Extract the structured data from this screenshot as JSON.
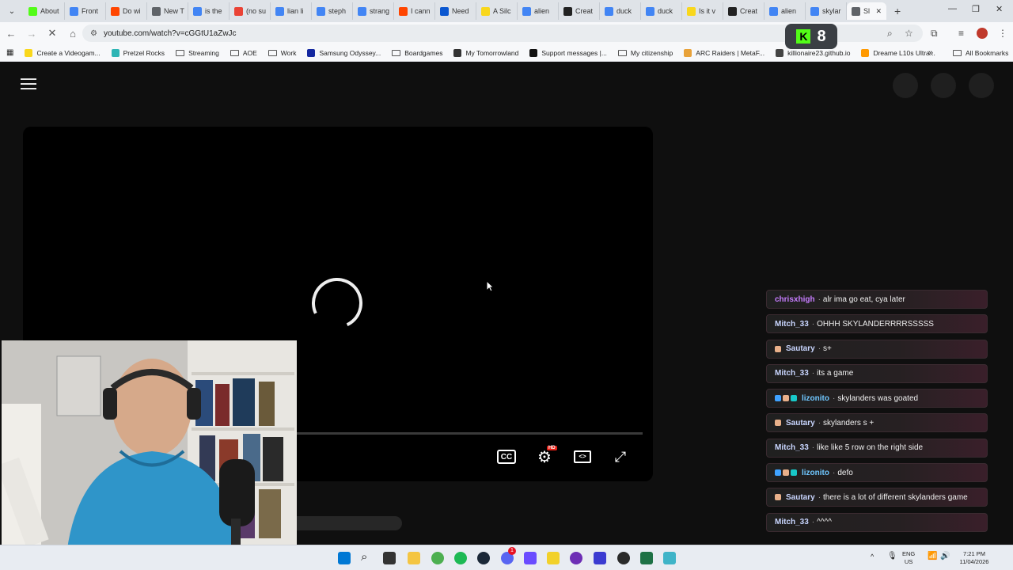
{
  "browser": {
    "tabs": [
      {
        "label": "About",
        "color": "#53fc18"
      },
      {
        "label": "Front",
        "color": "#4285f4"
      },
      {
        "label": "Do wi",
        "color": "#ff4500"
      },
      {
        "label": "New T",
        "color": "#5f6368"
      },
      {
        "label": "is the",
        "color": "#4285f4"
      },
      {
        "label": "(no su",
        "color": "#ea4335"
      },
      {
        "label": "lian li",
        "color": "#4285f4"
      },
      {
        "label": "steph",
        "color": "#4285f4"
      },
      {
        "label": "strang",
        "color": "#4285f4"
      },
      {
        "label": "I cann",
        "color": "#ff4500"
      },
      {
        "label": "Need",
        "color": "#0b57d0"
      },
      {
        "label": "A Silc",
        "color": "#f9d71c"
      },
      {
        "label": "alien",
        "color": "#4285f4"
      },
      {
        "label": "Creat",
        "color": "#222222"
      },
      {
        "label": "duck",
        "color": "#4285f4"
      },
      {
        "label": "duck",
        "color": "#4285f4"
      },
      {
        "label": "Is it v",
        "color": "#f9d71c"
      },
      {
        "label": "Creat",
        "color": "#222222"
      },
      {
        "label": "alien",
        "color": "#4285f4"
      },
      {
        "label": "skylar",
        "color": "#4285f4"
      },
      {
        "label": "Sl",
        "color": "#5f6368",
        "active": true
      }
    ],
    "new_tab": "+",
    "url": "youtube.com/watch?v=cGGtU1aZwJc",
    "kick_badge": "8",
    "bookmarks": [
      {
        "label": "Create a Videogam...",
        "type": "icon",
        "color": "#f9d71c"
      },
      {
        "label": "Pretzel Rocks",
        "type": "icon",
        "color": "#2eb5b5"
      },
      {
        "label": "Streaming",
        "type": "folder"
      },
      {
        "label": "AOE",
        "type": "folder"
      },
      {
        "label": "Work",
        "type": "folder"
      },
      {
        "label": "Samsung Odyssey...",
        "type": "icon",
        "color": "#1428a0"
      },
      {
        "label": "Boardgames",
        "type": "folder"
      },
      {
        "label": "My Tomorrowland",
        "type": "icon",
        "color": "#333333"
      },
      {
        "label": "Support messages |...",
        "type": "icon",
        "color": "#111111"
      },
      {
        "label": "My citizenship",
        "type": "folder"
      },
      {
        "label": "ARC Raiders | MetaF...",
        "type": "icon",
        "color": "#e8a23a"
      },
      {
        "label": "killionaire23.github.io",
        "type": "icon",
        "color": "#444444"
      },
      {
        "label": "Dreame L10s Ultra...",
        "type": "icon",
        "color": "#ff9900"
      }
    ],
    "all_bookmarks": "All Bookmarks",
    "bookmarks_more": "»"
  },
  "player": {
    "cc_label": "CC",
    "hd_badge": "HD"
  },
  "chat": [
    {
      "user": "chrisxhigh",
      "color": "#c77dff",
      "text": "alr ima go eat, cya later",
      "badges": []
    },
    {
      "user": "Mitch_33",
      "color": "#c9d6ff",
      "text": "OHHH SKYLANDERRRRSSSSS",
      "badges": []
    },
    {
      "user": "Sautary",
      "color": "#c9d6ff",
      "text": "s+",
      "badges": [
        "#e8b08a"
      ]
    },
    {
      "user": "Mitch_33",
      "color": "#c9d6ff",
      "text": "its a game",
      "badges": []
    },
    {
      "user": "lizonito",
      "color": "#6fc7ff",
      "text": "skylanders was goated",
      "badges": [
        "#3fa2ff",
        "#e8b08a",
        "#18c8c8"
      ]
    },
    {
      "user": "Sautary",
      "color": "#c9d6ff",
      "text": "skylanders s +",
      "badges": [
        "#e8b08a"
      ]
    },
    {
      "user": "Mitch_33",
      "color": "#c9d6ff",
      "text": "like like 5 row on the right side",
      "badges": []
    },
    {
      "user": "lizonito",
      "color": "#6fc7ff",
      "text": "defo",
      "badges": [
        "#3fa2ff",
        "#e8b08a",
        "#18c8c8"
      ]
    },
    {
      "user": "Sautary",
      "color": "#c9d6ff",
      "text": "there is a lot of different skylanders game",
      "badges": [
        "#e8b08a"
      ]
    },
    {
      "user": "Mitch_33",
      "color": "#c9d6ff",
      "text": "^^^^",
      "badges": []
    }
  ],
  "taskbar": {
    "language": "ENG",
    "region": "US",
    "time": "7:21 PM",
    "date": "11/04/2026",
    "discord_badge": "1"
  }
}
